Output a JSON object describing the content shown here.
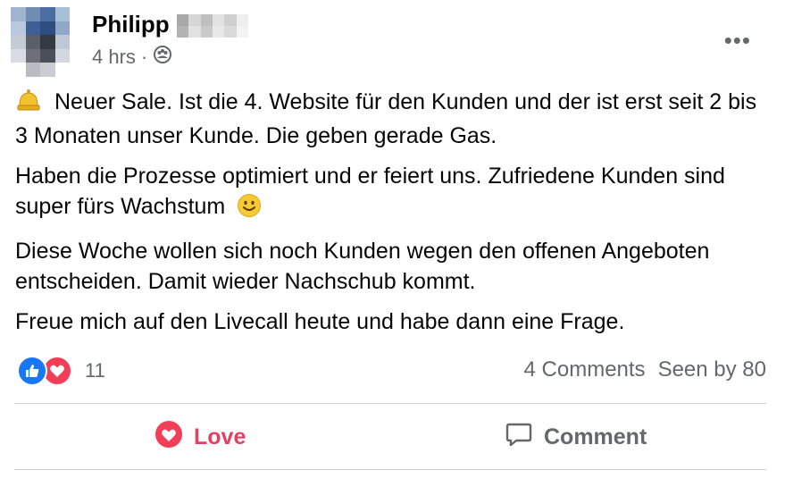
{
  "post": {
    "author_first": "Philipp",
    "time": "4 hrs",
    "separator": "·",
    "audience_icon": "friends-icon",
    "more_icon": "more-icon",
    "paragraph1": "Neuer Sale. Ist die 4. Website für den Kunden und der ist erst seit 2 bis 3 Monaten unser Kunde. Die geben gerade Gas.",
    "paragraph2": "Haben die Prozesse optimiert und er feiert uns. Zufriedene Kunden sind super fürs Wachstum",
    "paragraph3": "Diese Woche wollen sich noch Kunden wegen den offenen Angeboten entscheiden. Damit wieder Nachschub kommt.",
    "paragraph4": "Freue mich auf den Livecall heute und habe dann eine Frage.",
    "bell_emoji": "bell-icon",
    "smile_emoji": "smile-icon"
  },
  "reactions": {
    "count": "11",
    "types": [
      "like",
      "love"
    ]
  },
  "stats": {
    "comments": "4 Comments",
    "seen": "Seen by 80"
  },
  "actions": {
    "love_label": "Love",
    "comment_label": "Comment"
  },
  "colors": {
    "love": "#e4405f",
    "like": "#1877f2",
    "secondary_text": "#65676b",
    "divider": "#ced0d4"
  }
}
